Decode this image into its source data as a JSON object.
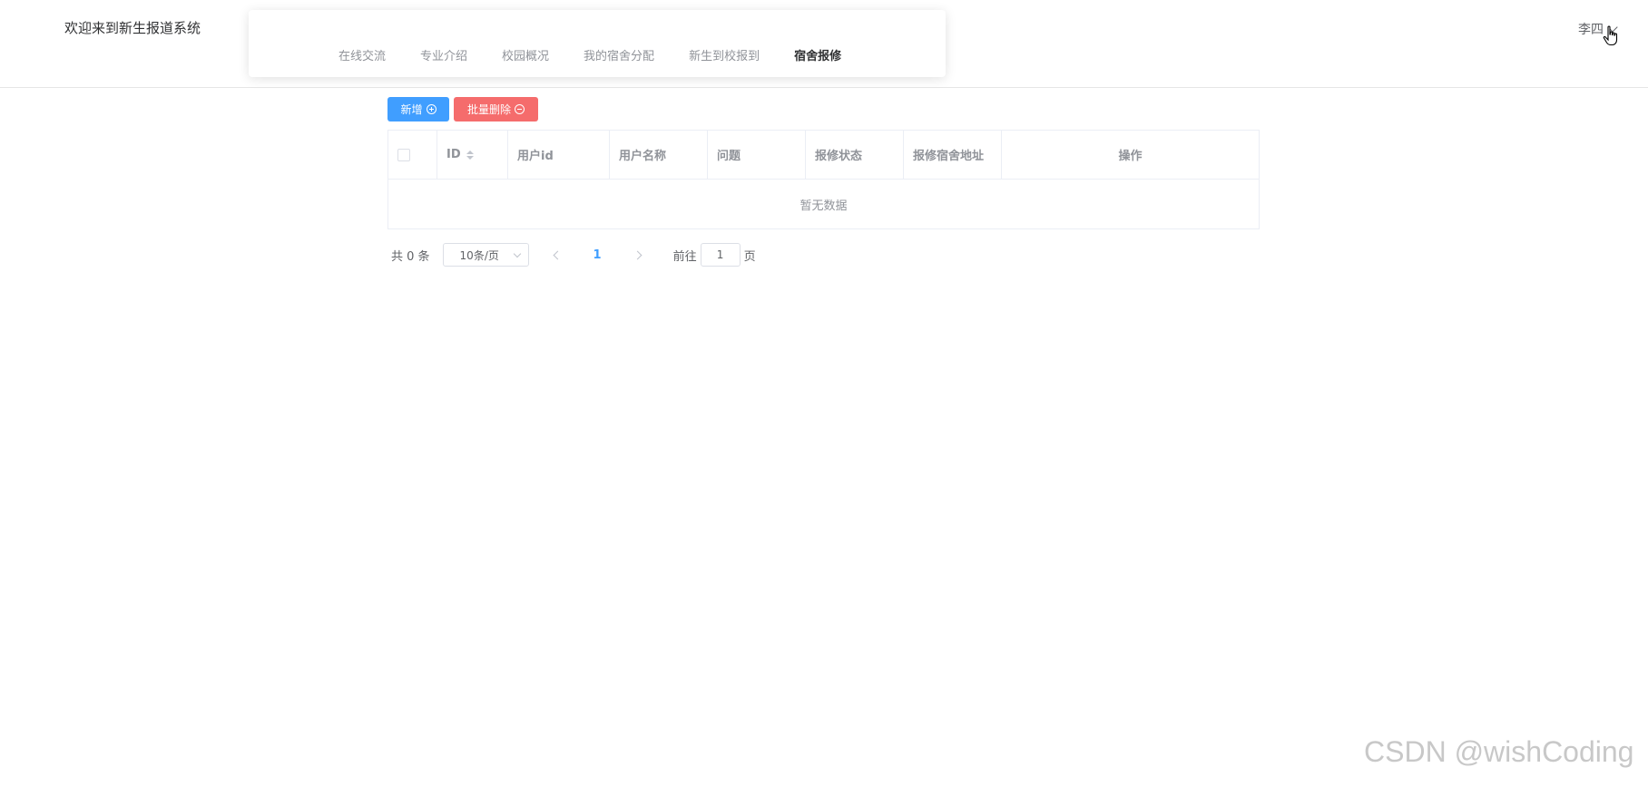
{
  "header": {
    "welcome": "欢迎来到新生报道系统",
    "nav": [
      {
        "label": "在线交流"
      },
      {
        "label": "专业介绍"
      },
      {
        "label": "校园概况"
      },
      {
        "label": "我的宿舍分配"
      },
      {
        "label": "新生到校报到"
      },
      {
        "label": "宿舍报修",
        "active": true
      }
    ],
    "user": "李四"
  },
  "toolbar": {
    "add_label": "新增",
    "batch_delete_label": "批量删除",
    "add_color": "#409eff",
    "delete_color": "#f56c6c"
  },
  "table": {
    "columns": [
      "ID",
      "用户id",
      "用户名称",
      "问题",
      "报修状态",
      "报修宿舍地址",
      "操作"
    ],
    "rows": [],
    "empty_text": "暂无数据"
  },
  "pagination": {
    "total_text": "共 0 条",
    "page_size": "10条/页",
    "current_page": "1",
    "goto_label": "前往",
    "goto_value": "1",
    "page_unit": "页",
    "accent": "#409eff"
  },
  "watermark": "CSDN @wishCoding"
}
